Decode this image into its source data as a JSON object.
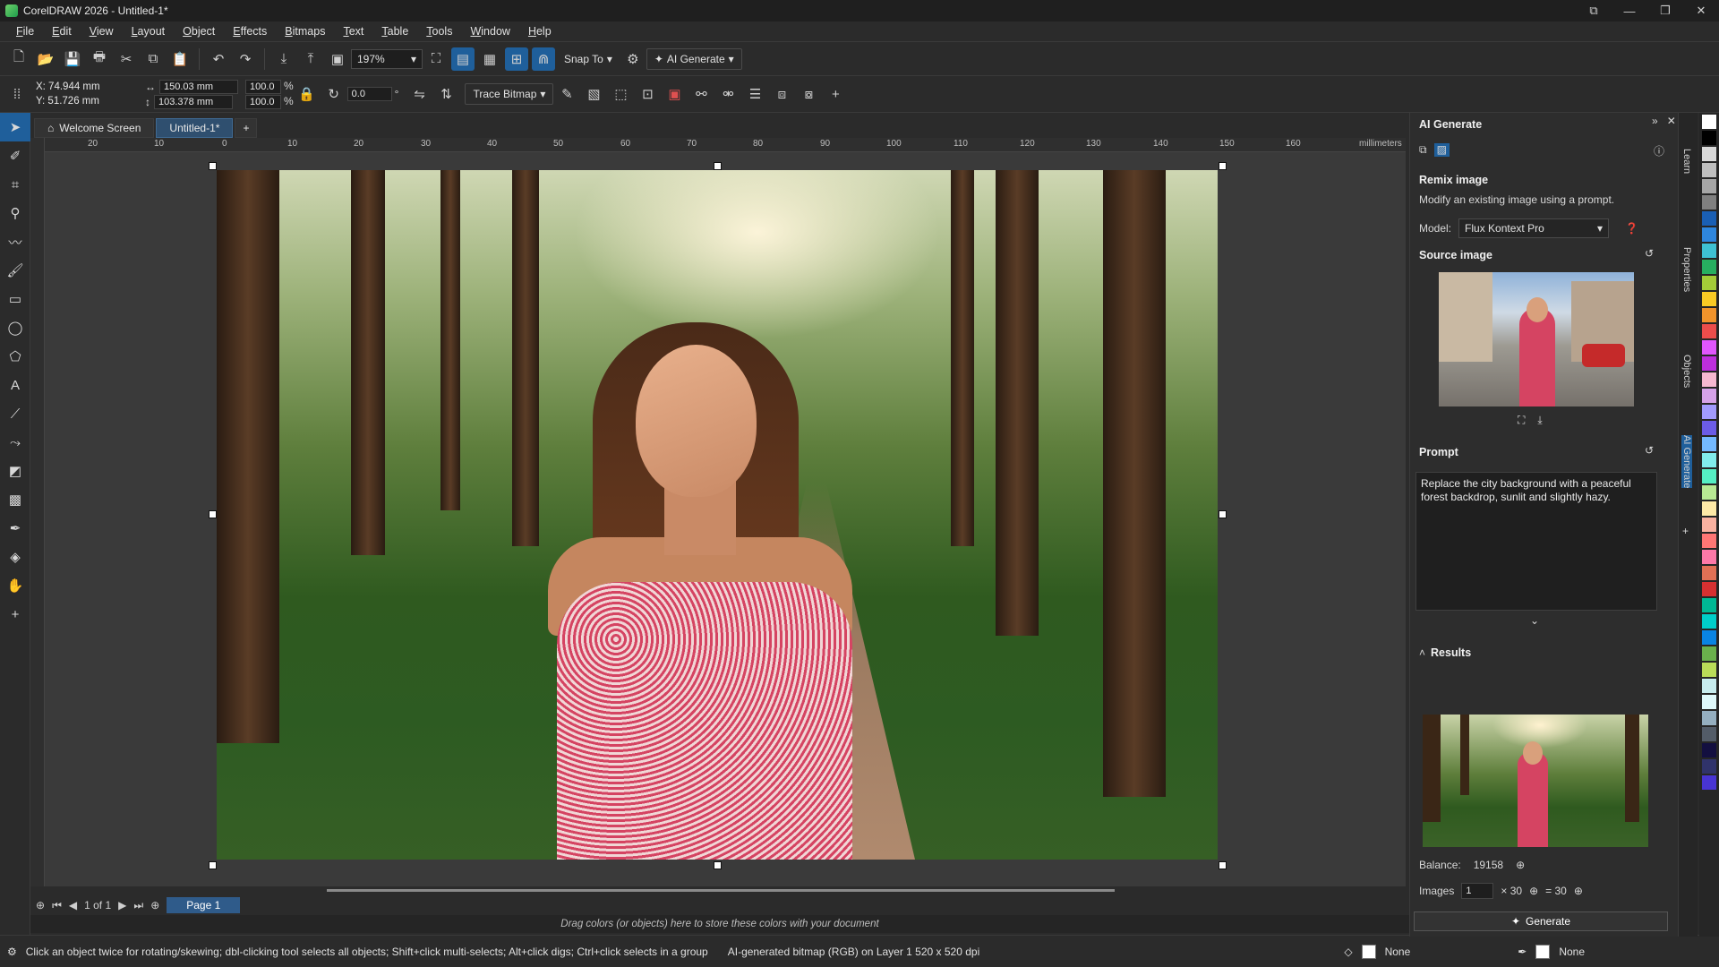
{
  "window": {
    "title": "CorelDRAW 2026 - Untitled-1*"
  },
  "menu": [
    "File",
    "Edit",
    "View",
    "Layout",
    "Object",
    "Effects",
    "Bitmaps",
    "Text",
    "Table",
    "Tools",
    "Window",
    "Help"
  ],
  "toolbar": {
    "zoom": "197%",
    "snap_to": "Snap To",
    "ai_generate": "AI Generate"
  },
  "properties": {
    "x": "X: 74.944 mm",
    "y": "Y: 51.726 mm",
    "w": "150.03 mm",
    "h": "103.378 mm",
    "scale_w": "100.0",
    "scale_h": "100.0",
    "pct": "%",
    "angle": "0.0",
    "deg": "°",
    "trace_bitmap": "Trace Bitmap"
  },
  "tabs": [
    {
      "label": "Welcome Screen"
    },
    {
      "label": "Untitled-1*"
    }
  ],
  "ruler": {
    "h_ticks": [
      "20",
      "10",
      "0",
      "10",
      "20",
      "30",
      "40",
      "50",
      "60",
      "70",
      "80",
      "90",
      "100",
      "110",
      "120",
      "130",
      "140",
      "150",
      "160"
    ],
    "unit": "millimeters"
  },
  "pages": {
    "counter": "1 of 1",
    "page_tab": "Page 1"
  },
  "colordock": {
    "hint": "Drag colors (or objects) here to store these colors with your document"
  },
  "status": {
    "message": "Click an object twice for rotating/skewing; dbl-clicking tool selects all objects; Shift+click multi-selects; Alt+click digs; Ctrl+click selects in a group",
    "object_info": "AI-generated bitmap (RGB) on Layer 1  520 x 520 dpi",
    "fill": "None",
    "outline": "None"
  },
  "panel": {
    "title": "AI Generate",
    "section": "Remix image",
    "description": "Modify an existing image using a prompt.",
    "model_label": "Model:",
    "model_value": "Flux Kontext Pro",
    "source_label": "Source image",
    "prompt_label": "Prompt",
    "prompt_text": "Replace the city background with a peaceful forest backdrop, sunlit and slightly hazy.",
    "results_label": "Results",
    "balance_label": "Balance:",
    "balance_value": "19158",
    "images_label": "Images",
    "images_count": "1",
    "cost": "× 30",
    "total": "= 30",
    "generate": "Generate"
  },
  "side_tabs": [
    "Learn",
    "Properties",
    "Objects",
    "AI Generate"
  ],
  "palette": [
    "#ffffff",
    "#000000",
    "#d9d9d9",
    "#bfbfbf",
    "#a6a6a6",
    "#808080",
    "#1a5fb4",
    "#2e86de",
    "#3ec1d3",
    "#27ae60",
    "#a3cb38",
    "#f9ca24",
    "#f0932b",
    "#eb4d4b",
    "#e056fd",
    "#be2edd",
    "#f6b8d0",
    "#d6a2e8",
    "#a29bfe",
    "#6c5ce7",
    "#74b9ff",
    "#81ecec",
    "#55efc4",
    "#b8e994",
    "#ffeaa7",
    "#fab1a0",
    "#ff7675",
    "#fd79a8",
    "#e17055",
    "#d63031",
    "#00b894",
    "#00cec9",
    "#0984e3",
    "#6ab04c",
    "#badc58",
    "#c7ecee",
    "#dff9fb",
    "#95afc0",
    "#535c68",
    "#130f40",
    "#30336b",
    "#4834d4"
  ]
}
